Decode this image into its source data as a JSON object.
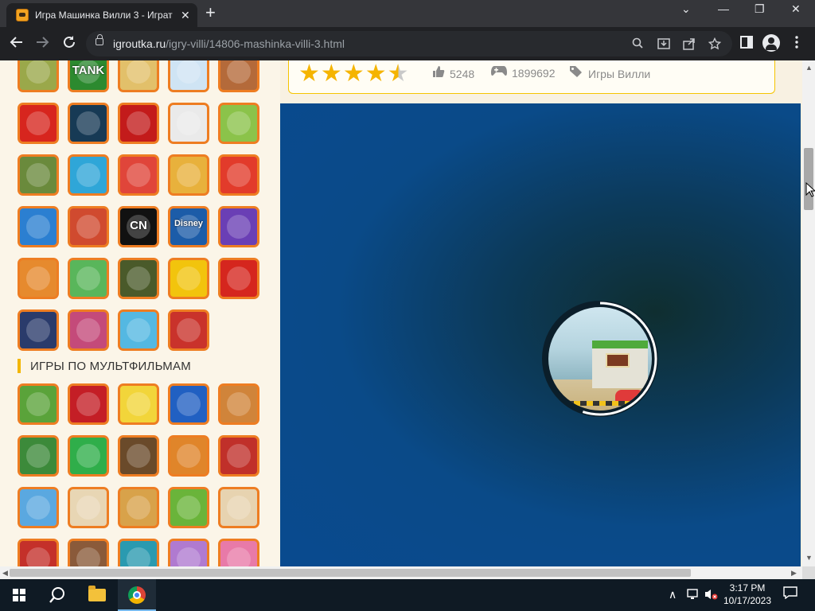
{
  "browser": {
    "tab_title": "Игра Машинка Вилли 3 - Играт",
    "tab_close": "✕",
    "new_tab": "+",
    "url_domain": "igroutka.ru",
    "url_path": "/igry-villi/14806-mashinka-villi-3.html",
    "win_min": "—",
    "win_restore": "❐",
    "win_close": "✕",
    "tab_search": "⌄",
    "icons": [
      "back-icon",
      "forward-icon",
      "reload-icon",
      "lock-icon",
      "search-icon",
      "install-icon",
      "share-icon",
      "bookmark-star-icon",
      "side-panel-icon",
      "profile-icon",
      "menu-icon"
    ]
  },
  "page": {
    "section_title": "ИГРЫ ПО МУЛЬТФИЛЬМАМ",
    "rating": {
      "stars_filled": 4.5,
      "stars_max": 5,
      "likes": "5248",
      "plays": "1899692",
      "category": "Игры Вилли"
    },
    "top_thumbs": [
      {
        "t": "",
        "c": "#9aa84a"
      },
      {
        "t": "TANK",
        "c": "#2c8a2f"
      },
      {
        "t": "",
        "c": "#e2c06a"
      },
      {
        "t": "",
        "c": "#cfe4f4"
      },
      {
        "t": "",
        "c": "#b46a3a"
      },
      {
        "t": "",
        "c": "#d7251e"
      },
      {
        "t": "",
        "c": "#173a55"
      },
      {
        "t": "",
        "c": "#c31b1b"
      },
      {
        "t": "",
        "c": "#eaeaea"
      },
      {
        "t": "",
        "c": "#8bc34a"
      },
      {
        "t": "",
        "c": "#6a8a3c"
      },
      {
        "t": "",
        "c": "#2fa6d8"
      },
      {
        "t": "",
        "c": "#e0453a"
      },
      {
        "t": "",
        "c": "#e8b13c"
      },
      {
        "t": "",
        "c": "#e23b2b"
      },
      {
        "t": "",
        "c": "#2b7fd1"
      },
      {
        "t": "",
        "c": "#d04a2f"
      },
      {
        "t": "CN",
        "c": "#111111"
      },
      {
        "t": "Disney",
        "c": "#1c5ca8"
      },
      {
        "t": "",
        "c": "#6a3fb5"
      },
      {
        "t": "",
        "c": "#e68a2e"
      },
      {
        "t": "",
        "c": "#59b65b"
      },
      {
        "t": "",
        "c": "#4a5a2a"
      },
      {
        "t": "",
        "c": "#f2c40d"
      },
      {
        "t": "",
        "c": "#d5261e"
      },
      {
        "t": "",
        "c": "#2a3b6b"
      },
      {
        "t": "",
        "c": "#c44a7a"
      },
      {
        "t": "",
        "c": "#54b8e2"
      },
      {
        "t": "",
        "c": "#c9322b"
      }
    ],
    "cartoon_thumbs": [
      {
        "t": "",
        "c": "#5aa33a"
      },
      {
        "t": "",
        "c": "#c41e26"
      },
      {
        "t": "",
        "c": "#f2d53a"
      },
      {
        "t": "",
        "c": "#2160c2"
      },
      {
        "t": "",
        "c": "#d0843a"
      },
      {
        "t": "",
        "c": "#3c8a3a"
      },
      {
        "t": "",
        "c": "#2fae4a"
      },
      {
        "t": "",
        "c": "#6a4a2a"
      },
      {
        "t": "",
        "c": "#e0852a"
      },
      {
        "t": "",
        "c": "#c0302a"
      },
      {
        "t": "",
        "c": "#5aa8e0"
      },
      {
        "t": "",
        "c": "#e8d6b4"
      },
      {
        "t": "",
        "c": "#d8a24a"
      },
      {
        "t": "",
        "c": "#6ab43a"
      },
      {
        "t": "",
        "c": "#e7d3b0"
      },
      {
        "t": "",
        "c": "#c4302a"
      },
      {
        "t": "",
        "c": "#8a5a3a"
      },
      {
        "t": "",
        "c": "#2a9ab0"
      },
      {
        "t": "",
        "c": "#b07ad0"
      },
      {
        "t": "",
        "c": "#e87aa8"
      }
    ],
    "loading_progress": 0.55
  },
  "taskbar": {
    "time": "3:17 PM",
    "date": "10/17/2023",
    "chevron": "∧",
    "notif": "☐"
  },
  "colors": {
    "thumb_border": "#ee7d22",
    "star_on": "#f5b400",
    "star_off": "#c9c9c9",
    "game_bg": "#094a8f"
  }
}
